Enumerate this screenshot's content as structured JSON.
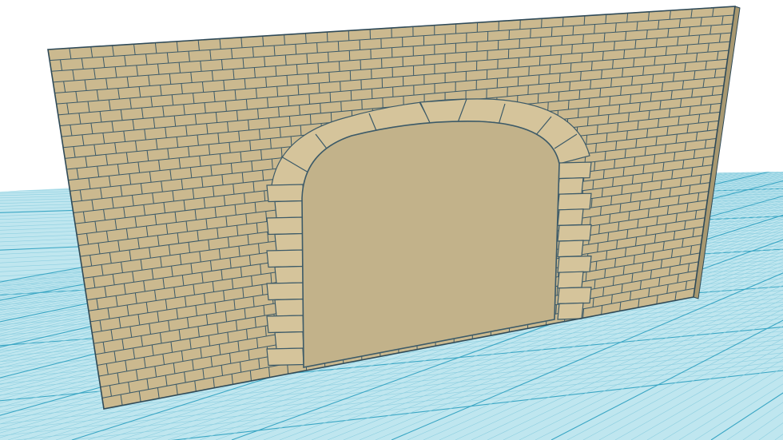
{
  "scene": {
    "model": "brick-wall-with-arched-opening",
    "colors": {
      "background": "#ffffff",
      "grid_fill": "#bfe6ef",
      "grid_minor": "#8ecfe0",
      "grid_major": "#3aa6c4",
      "brick_fill": "#cbb98f",
      "brick_face_light": "#d5c49b",
      "mortar_stroke": "#3c5a68",
      "opening_fill": "#c2b28a",
      "wall_edge": "#2f4a58",
      "wall_side": "#a89870"
    }
  }
}
